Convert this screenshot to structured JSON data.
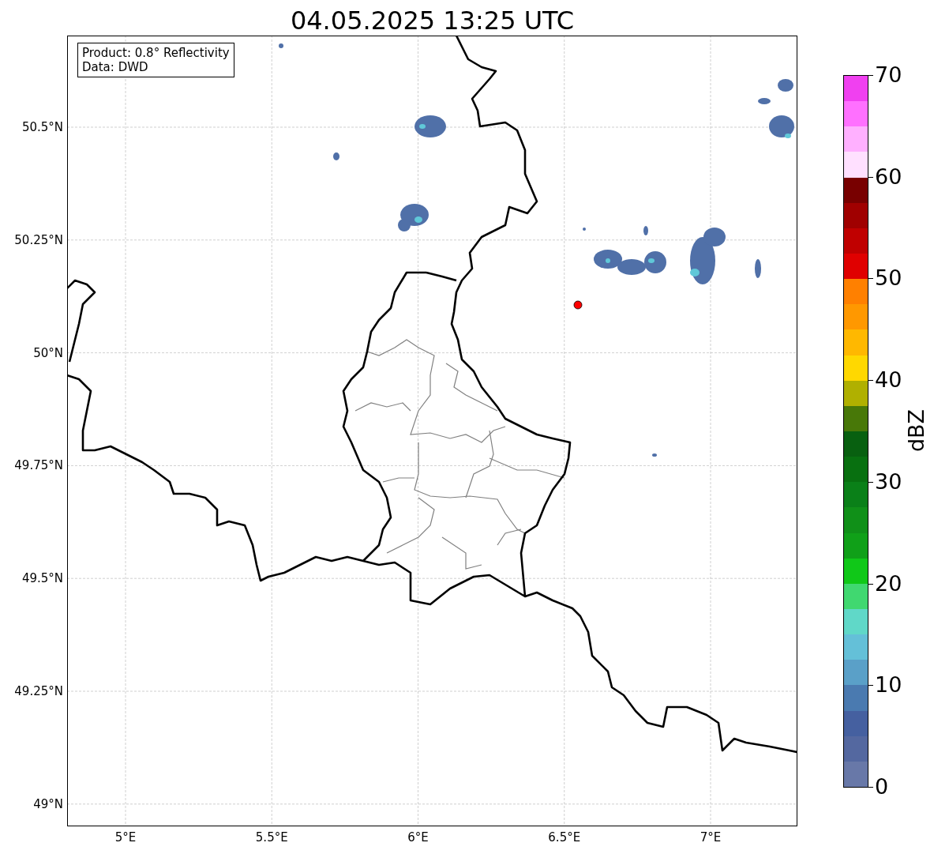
{
  "title": "04.05.2025 13:25 UTC",
  "info_box": {
    "lines": [
      "Product: 0.8° Reflectivity",
      "Data: DWD"
    ]
  },
  "map": {
    "lat_labels": [
      "50.5°N",
      "50.25°N",
      "50°N",
      "49.75°N",
      "49.5°N",
      "49.25°N",
      "49°N"
    ],
    "lon_labels": [
      "5°E",
      "5.5°E",
      "6°E",
      "6.5°E",
      "7°E"
    ]
  },
  "colorbar": {
    "label": "dBZ",
    "ticks": [
      "70",
      "60",
      "50",
      "40",
      "30",
      "20",
      "10",
      "0"
    ],
    "bins": [
      {
        "color": "#6878a8"
      },
      {
        "color": "#5468a0"
      },
      {
        "color": "#4560a0"
      },
      {
        "color": "#4a7ab0"
      },
      {
        "color": "#5aa0c8"
      },
      {
        "color": "#64c0d8"
      },
      {
        "color": "#60d8c8"
      },
      {
        "color": "#40d870"
      },
      {
        "color": "#10c818"
      },
      {
        "color": "#10a018"
      },
      {
        "color": "#109018"
      },
      {
        "color": "#0a8018"
      },
      {
        "color": "#087010"
      },
      {
        "color": "#086010"
      },
      {
        "color": "#487808"
      },
      {
        "color": "#b0b000"
      },
      {
        "color": "#ffd800"
      },
      {
        "color": "#ffb800"
      },
      {
        "color": "#ff9800"
      },
      {
        "color": "#ff8000"
      },
      {
        "color": "#e00000"
      },
      {
        "color": "#c00000"
      },
      {
        "color": "#a00000"
      },
      {
        "color": "#780000"
      },
      {
        "color": "#ffe0ff"
      },
      {
        "color": "#ffb0ff"
      },
      {
        "color": "#ff70ff"
      },
      {
        "color": "#f040f0"
      }
    ]
  }
}
